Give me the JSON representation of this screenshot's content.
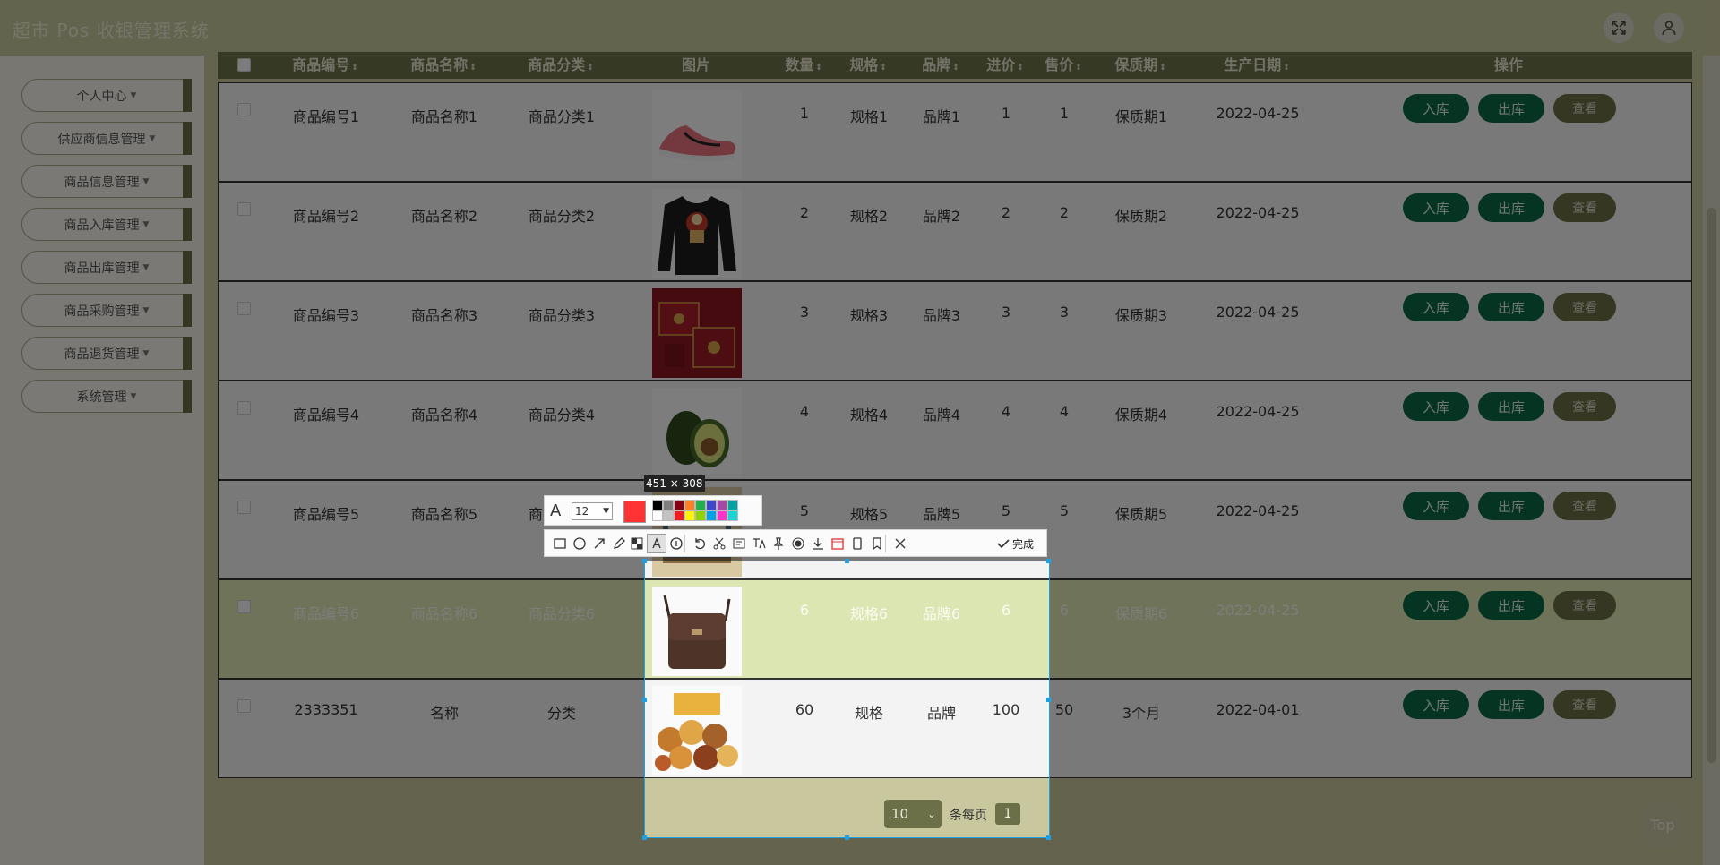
{
  "app": {
    "title": "超市 Pos 收银管理系统"
  },
  "sidebar": {
    "items": [
      {
        "label": "个人中心"
      },
      {
        "label": "供应商信息管理"
      },
      {
        "label": "商品信息管理"
      },
      {
        "label": "商品入库管理"
      },
      {
        "label": "商品出库管理"
      },
      {
        "label": "商品采购管理"
      },
      {
        "label": "商品退货管理"
      },
      {
        "label": "系统管理"
      }
    ],
    "caret": "▼"
  },
  "table": {
    "sort_glyph": "⇕",
    "columns": [
      "商品编号",
      "商品名称",
      "商品分类",
      "图片",
      "数量",
      "规格",
      "品牌",
      "进价",
      "售价",
      "保质期",
      "生产日期",
      "操作"
    ],
    "rows": [
      {
        "code": "商品编号1",
        "name": "商品名称1",
        "category": "商品分类1",
        "image": "pink-sneaker",
        "qty": "1",
        "spec": "规格1",
        "brand": "品牌1",
        "cost": "1",
        "price": "1",
        "shelf_life": "保质期1",
        "date": "2022-04-25"
      },
      {
        "code": "商品编号2",
        "name": "商品名称2",
        "category": "商品分类2",
        "image": "black-sweatshirt",
        "qty": "2",
        "spec": "规格2",
        "brand": "品牌2",
        "cost": "2",
        "price": "2",
        "shelf_life": "保质期2",
        "date": "2022-04-25"
      },
      {
        "code": "商品编号3",
        "name": "商品名称3",
        "category": "商品分类3",
        "image": "red-gift-box",
        "qty": "3",
        "spec": "规格3",
        "brand": "品牌3",
        "cost": "3",
        "price": "3",
        "shelf_life": "保质期3",
        "date": "2022-04-25"
      },
      {
        "code": "商品编号4",
        "name": "商品名称4",
        "category": "商品分类4",
        "image": "avocado",
        "qty": "4",
        "spec": "规格4",
        "brand": "品牌4",
        "cost": "4",
        "price": "4",
        "shelf_life": "保质期4",
        "date": "2022-04-25"
      },
      {
        "code": "商品编号5",
        "name": "商品名称5",
        "category": "商品分类5",
        "image": "book",
        "qty": "5",
        "spec": "规格5",
        "brand": "品牌5",
        "cost": "5",
        "price": "5",
        "shelf_life": "保质期5",
        "date": "2022-04-25"
      },
      {
        "code": "商品编号6",
        "name": "商品名称6",
        "category": "商品分类6",
        "image": "leather-bag",
        "qty": "6",
        "spec": "规格6",
        "brand": "品牌6",
        "cost": "6",
        "price": "6",
        "shelf_life": "保质期6",
        "date": "2022-04-25"
      },
      {
        "code": "2333351",
        "name": "名称",
        "category": "分类",
        "image": "snack-pile",
        "qty": "60",
        "spec": "规格",
        "brand": "品牌",
        "cost": "100",
        "price": "50",
        "shelf_life": "3个月",
        "date": "2022-04-01"
      }
    ],
    "actions": {
      "stock_in": "入库",
      "stock_out": "出库",
      "view": "查看"
    }
  },
  "pager": {
    "page_size": "10",
    "per_page_label": "条每页",
    "current_page": "1"
  },
  "back_to_top": "Top",
  "screenshot_tool": {
    "size_label": "451 × 308",
    "font_size": "12",
    "current_color": "#ff3333",
    "palette": [
      "#000000",
      "#7f7f7f",
      "#880015",
      "#ff7f27",
      "#22b14c",
      "#3f48cc",
      "#a349a4",
      "#00a2a2",
      "#ffffff",
      "#c3c3c3",
      "#ed1c24",
      "#fff200",
      "#8fd400",
      "#00a2e8",
      "#ff33cc",
      "#18d4d4"
    ],
    "done_label": "完成",
    "tools": [
      "rectangle-icon",
      "ellipse-icon",
      "arrow-icon",
      "pencil-icon",
      "mosaic-icon",
      "text-icon",
      "number-icon",
      "undo-icon",
      "scissors-icon",
      "ocr-icon",
      "translate-icon",
      "pin-icon",
      "record-icon",
      "download-icon",
      "calendar-icon",
      "phone-icon",
      "bookmark-icon",
      "close-icon"
    ]
  }
}
